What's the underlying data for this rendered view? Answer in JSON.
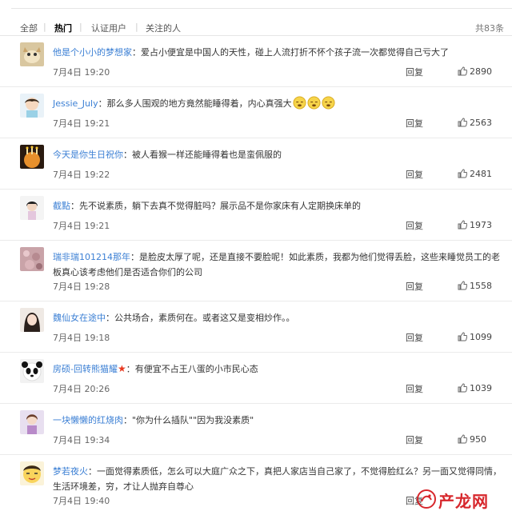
{
  "tabs": {
    "all": "全部",
    "hot": "热门",
    "verified": "认证用户",
    "following": "关注的人",
    "total": "共83条"
  },
  "actions": {
    "reply": "回复"
  },
  "comments": [
    {
      "user": "他是个小小的梦想家",
      "text": "：爱占小便宜是中国人的天性，碰上人流打折不怀个孩子流一次都觉得自己亏大了",
      "time": "7月4日 19:20",
      "likes": "2890"
    },
    {
      "user": "Jessie_July",
      "text": "：那么多人围观的地方竟然能睡得着，内心真强大",
      "time": "7月4日 19:21",
      "likes": "2563"
    },
    {
      "user": "今天是你生日祝你",
      "text": "：被人看猴一样还能睡得着也是蛮佩服的",
      "time": "7月4日 19:22",
      "likes": "2481"
    },
    {
      "user": "截點",
      "text": "：先不说素质，躺下去真不觉得脏吗？展示品不是你家床有人定期换床单的",
      "time": "7月4日 19:21",
      "likes": "1973"
    },
    {
      "user": "瑞非瑞101214那年",
      "text": "：是脸皮太厚了呢，还是直接不要脸呢！如此素质，我都为他们觉得丢脸，这些来睡觉员工的老板真心该考虑他们是否适合你们的公司",
      "time": "7月4日 19:28",
      "likes": "1558"
    },
    {
      "user": "魏仙女在途中",
      "text": "：公共场合，素质何在。或者这又是变相炒作。。",
      "time": "7月4日 19:18",
      "likes": "1099"
    },
    {
      "user": "房硕-回转熊猫耀",
      "text": "：有便宜不占王八蛋的小市民心态",
      "time": "7月4日 20:26",
      "likes": "1039"
    },
    {
      "user": "一块懒懒的红烧肉",
      "text": "：\"你为什么插队\"\"因为我没素质\"",
      "time": "7月4日 19:34",
      "likes": "950"
    },
    {
      "user": "梦若夜火",
      "text": "：一面觉得素质低，怎么可以大庭广众之下，真把人家店当自己家了，不觉得脸红么？另一面又觉得同情，生活环境差，穷，才让人抛弃自尊心",
      "time": "7月4日 19:40",
      "likes": ""
    }
  ],
  "watermark": {
    "text": "产龙网"
  },
  "colors": {
    "username": "#3b7fd4",
    "watermark": "#d7272c",
    "star": "#e8381f"
  }
}
